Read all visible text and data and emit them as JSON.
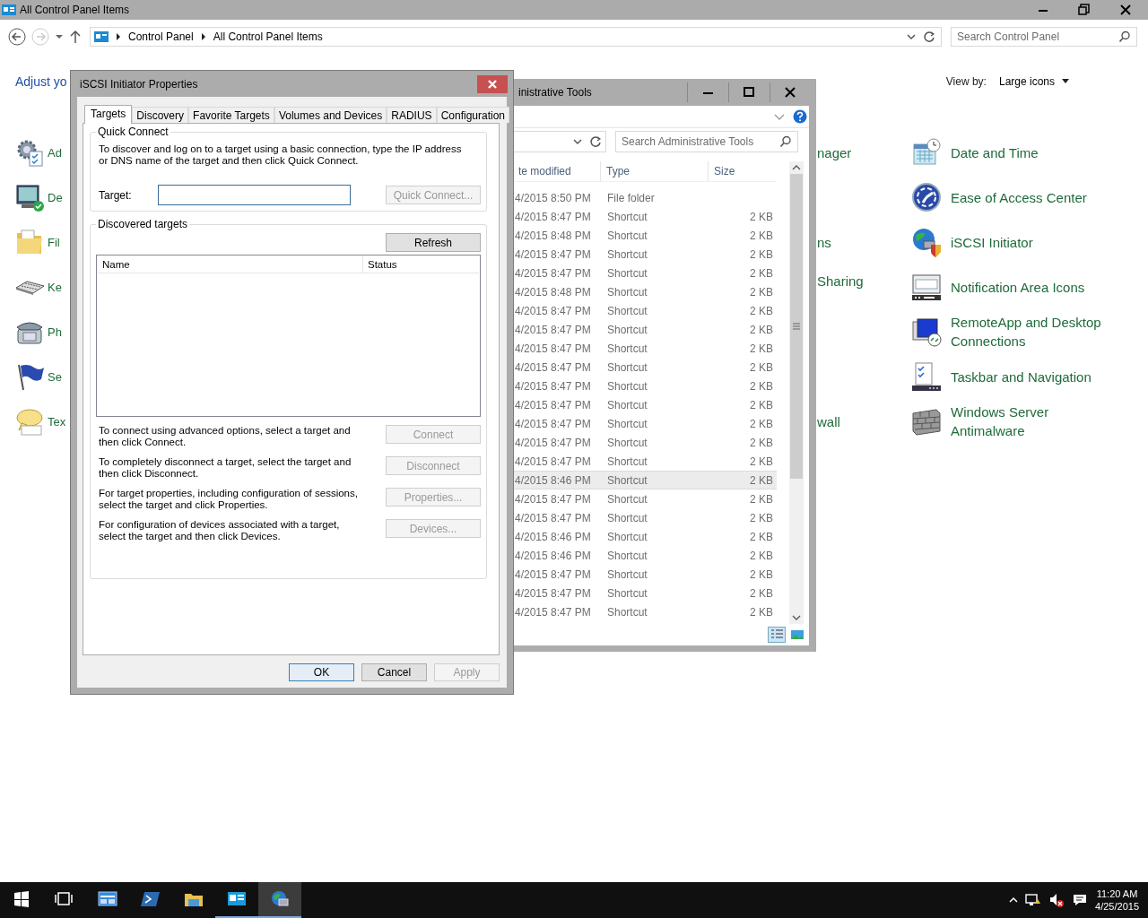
{
  "control_panel": {
    "title": "All Control Panel Items",
    "breadcrumb": [
      "Control Panel",
      "All Control Panel Items"
    ],
    "search": {
      "placeholder": "Search Control Panel"
    },
    "heading": "Adjust yo",
    "view_by": {
      "label": "View by:",
      "value": "Large icons"
    },
    "column_1": [
      "Ad",
      "De",
      "Fil",
      "Ke",
      "Ph",
      "Se",
      "Tex"
    ],
    "column_2": [
      "nager",
      "ns",
      "Sharing",
      "wall"
    ],
    "column_3": [
      "Date and Time",
      "Ease of Access Center",
      "iSCSI Initiator",
      "Notification Area Icons",
      "RemoteApp and Desktop Connections",
      "Taskbar and Navigation",
      "Windows Server Antimalware"
    ]
  },
  "admin_tools": {
    "title": "inistrative Tools",
    "search": {
      "placeholder": "Search Administrative Tools"
    },
    "columns": [
      "te modified",
      "Type",
      "Size"
    ],
    "rows": [
      {
        "date": "4/2015 8:50 PM",
        "type": "File folder",
        "selected": false
      },
      {
        "date": "4/2015 8:47 PM",
        "type": "Shortcut",
        "size": "2 KB",
        "selected": false
      },
      {
        "date": "4/2015 8:48 PM",
        "type": "Shortcut",
        "size": "2 KB",
        "selected": false
      },
      {
        "date": "4/2015 8:47 PM",
        "type": "Shortcut",
        "size": "2 KB",
        "selected": false
      },
      {
        "date": "4/2015 8:47 PM",
        "type": "Shortcut",
        "size": "2 KB",
        "selected": false
      },
      {
        "date": "4/2015 8:48 PM",
        "type": "Shortcut",
        "size": "2 KB",
        "selected": false
      },
      {
        "date": "4/2015 8:47 PM",
        "type": "Shortcut",
        "size": "2 KB",
        "selected": false
      },
      {
        "date": "4/2015 8:47 PM",
        "type": "Shortcut",
        "size": "2 KB",
        "selected": false
      },
      {
        "date": "4/2015 8:47 PM",
        "type": "Shortcut",
        "size": "2 KB",
        "selected": false
      },
      {
        "date": "4/2015 8:47 PM",
        "type": "Shortcut",
        "size": "2 KB",
        "selected": false
      },
      {
        "date": "4/2015 8:47 PM",
        "type": "Shortcut",
        "size": "2 KB",
        "selected": false
      },
      {
        "date": "4/2015 8:47 PM",
        "type": "Shortcut",
        "size": "2 KB",
        "selected": false
      },
      {
        "date": "4/2015 8:47 PM",
        "type": "Shortcut",
        "size": "2 KB",
        "selected": false
      },
      {
        "date": "4/2015 8:47 PM",
        "type": "Shortcut",
        "size": "2 KB",
        "selected": false
      },
      {
        "date": "4/2015 8:47 PM",
        "type": "Shortcut",
        "size": "2 KB",
        "selected": false
      },
      {
        "date": "4/2015 8:46 PM",
        "type": "Shortcut",
        "size": "2 KB",
        "selected": true
      },
      {
        "date": "4/2015 8:47 PM",
        "type": "Shortcut",
        "size": "2 KB",
        "selected": false
      },
      {
        "date": "4/2015 8:47 PM",
        "type": "Shortcut",
        "size": "2 KB",
        "selected": false
      },
      {
        "date": "4/2015 8:46 PM",
        "type": "Shortcut",
        "size": "2 KB",
        "selected": false
      },
      {
        "date": "4/2015 8:46 PM",
        "type": "Shortcut",
        "size": "2 KB",
        "selected": false
      },
      {
        "date": "4/2015 8:47 PM",
        "type": "Shortcut",
        "size": "2 KB",
        "selected": false
      },
      {
        "date": "4/2015 8:47 PM",
        "type": "Shortcut",
        "size": "2 KB",
        "selected": false
      },
      {
        "date": "4/2015 8:47 PM",
        "type": "Shortcut",
        "size": "2 KB",
        "selected": false
      }
    ]
  },
  "dialog": {
    "title": "iSCSI Initiator Properties",
    "tabs": [
      {
        "label": "Targets",
        "selected": true
      },
      {
        "label": "Discovery",
        "selected": false
      },
      {
        "label": "Favorite Targets",
        "selected": false
      },
      {
        "label": "Volumes and Devices",
        "selected": false
      },
      {
        "label": "RADIUS",
        "selected": false
      },
      {
        "label": "Configuration",
        "selected": false
      }
    ],
    "quick_connect": {
      "legend": "Quick Connect",
      "text": "To discover and log on to a target using a basic connection, type the IP address or DNS name of the target and then click Quick Connect.",
      "target_label": "Target:",
      "button": {
        "label": "Quick Connect...",
        "disabled": true
      }
    },
    "discovered": {
      "legend": "Discovered targets",
      "refresh": {
        "label": "Refresh",
        "disabled": false
      },
      "columns": [
        "Name",
        "Status"
      ],
      "actions": [
        {
          "text": "To connect using advanced options, select a target and then click Connect.",
          "button": {
            "label": "Connect",
            "disabled": true
          }
        },
        {
          "text": "To completely disconnect a target, select the target and then click Disconnect.",
          "button": {
            "label": "Disconnect",
            "disabled": true
          }
        },
        {
          "text": "For target properties, including configuration of sessions, select the target and click Properties.",
          "button": {
            "label": "Properties...",
            "disabled": true
          }
        },
        {
          "text": "For configuration of devices associated with a target, select the target and then click Devices.",
          "button": {
            "label": "Devices...",
            "disabled": true
          }
        }
      ]
    },
    "buttons": [
      {
        "label": "OK",
        "disabled": false,
        "default": true
      },
      {
        "label": "Cancel",
        "disabled": false,
        "default": false
      },
      {
        "label": "Apply",
        "disabled": true,
        "default": false
      }
    ]
  },
  "taskbar": {
    "apps": [
      {
        "running": false,
        "active": false
      },
      {
        "running": false,
        "active": false
      },
      {
        "running": false,
        "active": false
      },
      {
        "running": false,
        "active": false
      },
      {
        "running": true,
        "active": false
      },
      {
        "running": true,
        "active": true
      }
    ],
    "clock": {
      "time": "11:20 AM",
      "date": "4/25/2015"
    }
  }
}
